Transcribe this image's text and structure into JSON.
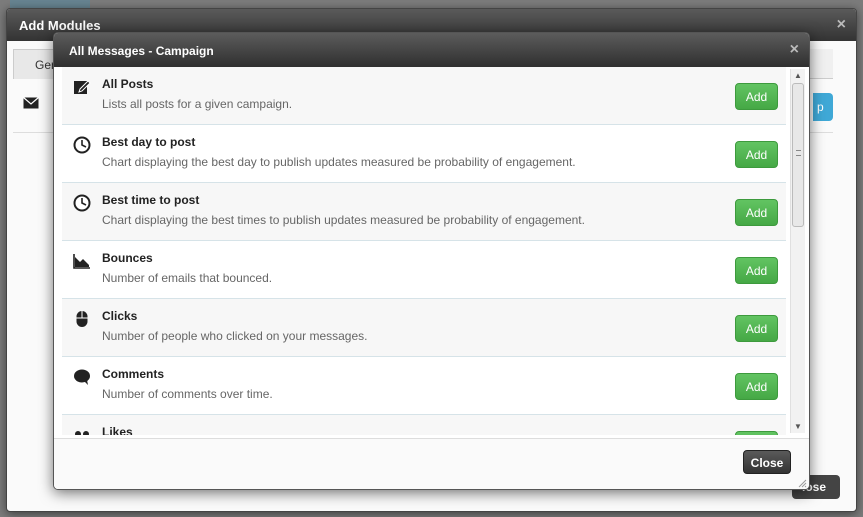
{
  "outer_modal": {
    "title": "Add Modules",
    "close_symbol": "×",
    "tab_label": "Ger",
    "row_icon": "envelope-icon",
    "blue_button_label": "p",
    "footer_button_label": "lose"
  },
  "inner_modal": {
    "title": "All Messages - Campaign",
    "close_symbol": "×",
    "add_label": "Add",
    "close_label": "Close",
    "modules": [
      {
        "title": "All Posts",
        "description": "Lists all posts for a given campaign.",
        "icon": "edit-icon"
      },
      {
        "title": "Best day to post",
        "description": "Chart displaying the best day to publish updates measured be probability of engagement.",
        "icon": "clock-icon"
      },
      {
        "title": "Best time to post",
        "description": "Chart displaying the best times to publish updates measured be probability of engagement.",
        "icon": "clock-icon"
      },
      {
        "title": "Bounces",
        "description": "Number of emails that bounced.",
        "icon": "chart-down-icon"
      },
      {
        "title": "Clicks",
        "description": "Number of people who clicked on your messages.",
        "icon": "mouse-icon"
      },
      {
        "title": "Comments",
        "description": "Number of comments over time.",
        "icon": "comment-icon"
      },
      {
        "title": "Likes",
        "description": "",
        "icon": "likes-icon"
      }
    ]
  },
  "colors": {
    "add_button": "#4cae4c",
    "header": "#333333",
    "row_border": "#d6e3e8"
  }
}
